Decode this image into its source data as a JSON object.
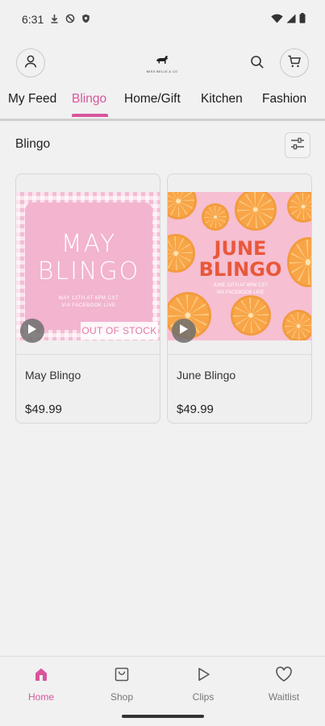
{
  "status_bar": {
    "time": "6:31",
    "icons_left": [
      "download-icon",
      "nfc-icon",
      "shield-icon"
    ],
    "icons_right": [
      "wifi-icon",
      "signal-icon",
      "battery-icon"
    ]
  },
  "header": {
    "logo_text": "MISS BELLE & CO",
    "icons": [
      "profile-icon",
      "logo-icon",
      "search-icon",
      "cart-icon"
    ]
  },
  "tabs": [
    {
      "label": "My Feed",
      "active": false
    },
    {
      "label": "Blingo",
      "active": true
    },
    {
      "label": "Home/Gift",
      "active": false
    },
    {
      "label": "Kitchen",
      "active": false
    },
    {
      "label": "Fashion",
      "active": false
    }
  ],
  "section": {
    "title": "Blingo",
    "filter_icon": "sliders-icon"
  },
  "products": [
    {
      "name": "May Blingo",
      "price": "$49.99",
      "badge": "OUT OF STOCK",
      "image": {
        "title_line1": "MAY",
        "title_line2": "BLINGO",
        "sub_line1": "MAY 13TH AT 8PM CST",
        "sub_line2": "VIA FACEBOOK LIVE"
      }
    },
    {
      "name": "June Blingo",
      "price": "$49.99",
      "badge": "",
      "image": {
        "title_line1": "JUNE",
        "title_line2": "BLINGO",
        "sub_line1": "JUNE 10TH AT 8PM CST",
        "sub_line2": "VIA FACEBOOK LIVE"
      }
    }
  ],
  "bottom_nav": [
    {
      "label": "Home",
      "icon": "home-icon",
      "active": true
    },
    {
      "label": "Shop",
      "icon": "shop-bag-icon",
      "active": false
    },
    {
      "label": "Clips",
      "icon": "play-icon",
      "active": false
    },
    {
      "label": "Waitlist",
      "icon": "heart-icon",
      "active": false
    }
  ],
  "colors": {
    "accent": "#d9559d",
    "background": "#f1f1f1",
    "june_title": "#e9583a",
    "badge_text": "#e07aa8"
  }
}
